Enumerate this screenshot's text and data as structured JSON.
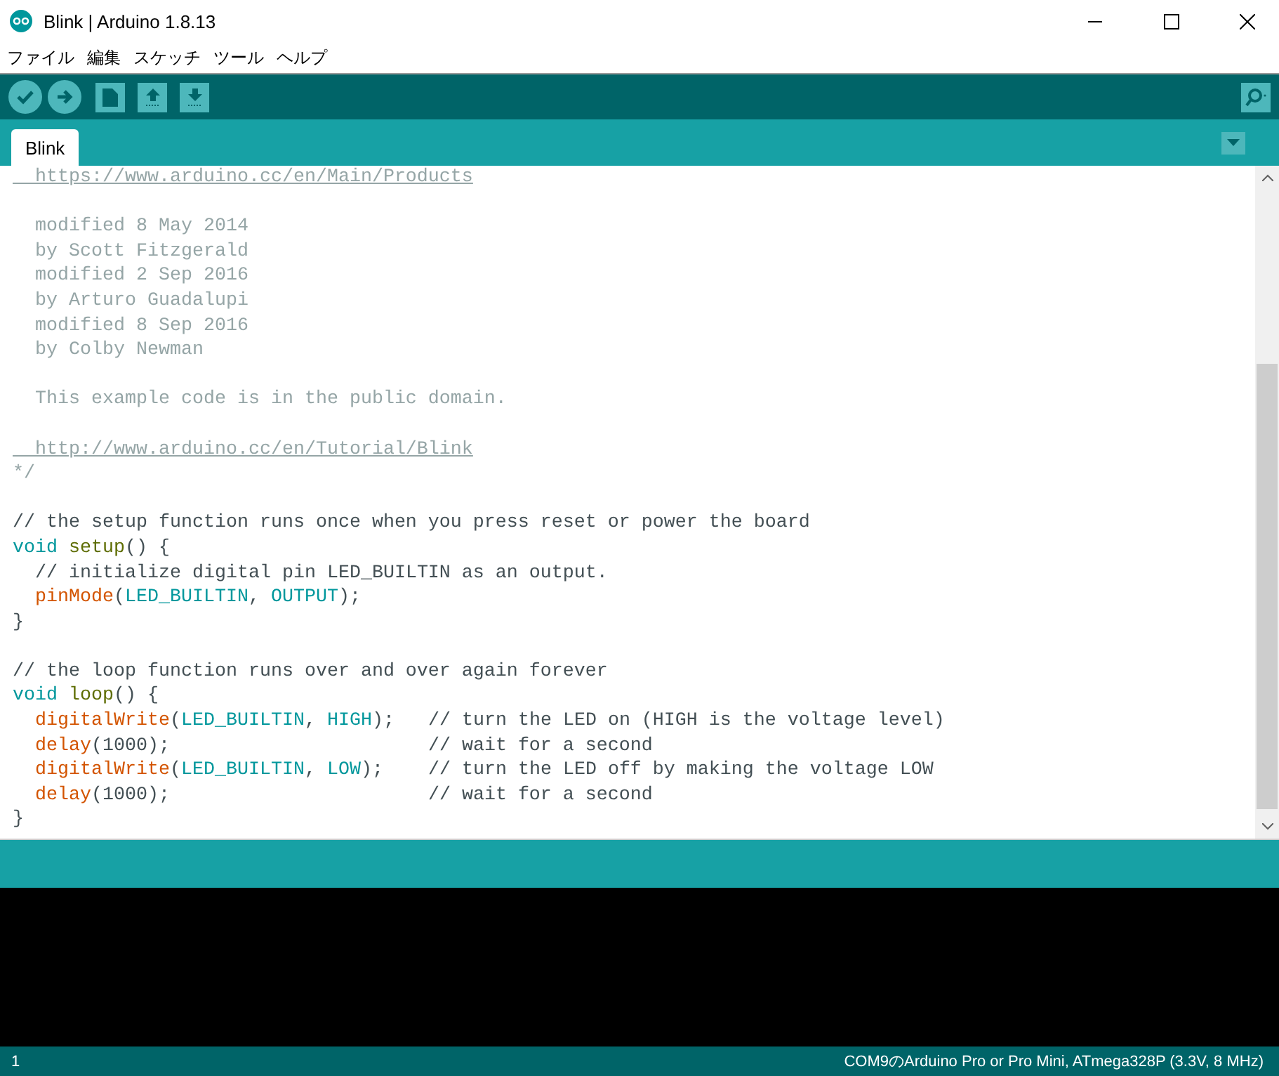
{
  "window": {
    "title": "Blink | Arduino 1.8.13"
  },
  "menu": [
    "ファイル",
    "編集",
    "スケッチ",
    "ツール",
    "ヘルプ"
  ],
  "tabs": [
    {
      "label": "Blink",
      "selected": true
    }
  ],
  "code_lines": [
    {
      "kind": "code",
      "indent": false,
      "tokens": [
        {
          "kind": "link",
          "text": "  https://www.arduino.cc/en/Main/Products"
        }
      ]
    },
    {
      "kind": "blank"
    },
    {
      "kind": "code",
      "indent": false,
      "tokens": [
        {
          "kind": "block",
          "text": "  modified 8 May 2014"
        }
      ]
    },
    {
      "kind": "code",
      "indent": false,
      "tokens": [
        {
          "kind": "block",
          "text": "  by Scott Fitzgerald"
        }
      ]
    },
    {
      "kind": "code",
      "indent": false,
      "tokens": [
        {
          "kind": "block",
          "text": "  modified 2 Sep 2016"
        }
      ]
    },
    {
      "kind": "code",
      "indent": false,
      "tokens": [
        {
          "kind": "block",
          "text": "  by Arturo Guadalupi"
        }
      ]
    },
    {
      "kind": "code",
      "indent": false,
      "tokens": [
        {
          "kind": "block",
          "text": "  modified 8 Sep 2016"
        }
      ]
    },
    {
      "kind": "code",
      "indent": false,
      "tokens": [
        {
          "kind": "block",
          "text": "  by Colby Newman"
        }
      ]
    },
    {
      "kind": "blank"
    },
    {
      "kind": "code",
      "indent": false,
      "tokens": [
        {
          "kind": "block",
          "text": "  This example code is in the public domain."
        }
      ]
    },
    {
      "kind": "blank"
    },
    {
      "kind": "code",
      "indent": false,
      "tokens": [
        {
          "kind": "link",
          "text": "  http://www.arduino.cc/en/Tutorial/Blink"
        }
      ]
    },
    {
      "kind": "code",
      "indent": false,
      "tokens": [
        {
          "kind": "block",
          "text": "*/"
        }
      ]
    },
    {
      "kind": "blank"
    },
    {
      "kind": "code",
      "indent": false,
      "tokens": [
        {
          "kind": "comment",
          "text": "// the setup function runs once when you press reset or power the board"
        }
      ]
    },
    {
      "kind": "code",
      "indent": false,
      "tokens": [
        {
          "kind": "keyword",
          "text": "void "
        },
        {
          "kind": "name",
          "text": "setup"
        },
        {
          "kind": "plain",
          "text": "() {"
        }
      ]
    },
    {
      "kind": "code",
      "indent": true,
      "tokens": [
        {
          "kind": "comment",
          "text": "// initialize digital pin LED_BUILTIN as an output."
        }
      ]
    },
    {
      "kind": "code",
      "indent": true,
      "tokens": [
        {
          "kind": "function",
          "text": "pinMode"
        },
        {
          "kind": "plain",
          "text": "("
        },
        {
          "kind": "constant",
          "text": "LED_BUILTIN"
        },
        {
          "kind": "plain",
          "text": ", "
        },
        {
          "kind": "constant",
          "text": "OUTPUT"
        },
        {
          "kind": "plain",
          "text": ");"
        }
      ]
    },
    {
      "kind": "code",
      "indent": false,
      "tokens": [
        {
          "kind": "plain",
          "text": "}"
        }
      ]
    },
    {
      "kind": "blank"
    },
    {
      "kind": "code",
      "indent": false,
      "tokens": [
        {
          "kind": "comment",
          "text": "// the loop function runs over and over again forever"
        }
      ]
    },
    {
      "kind": "code",
      "indent": false,
      "tokens": [
        {
          "kind": "keyword",
          "text": "void "
        },
        {
          "kind": "name",
          "text": "loop"
        },
        {
          "kind": "plain",
          "text": "() {"
        }
      ]
    },
    {
      "kind": "code",
      "indent": true,
      "tokens": [
        {
          "kind": "function",
          "text": "digitalWrite"
        },
        {
          "kind": "plain",
          "text": "("
        },
        {
          "kind": "constant",
          "text": "LED_BUILTIN"
        },
        {
          "kind": "plain",
          "text": ", "
        },
        {
          "kind": "constant",
          "text": "HIGH"
        },
        {
          "kind": "plain",
          "text": ");   "
        },
        {
          "kind": "comment",
          "text": "// turn the LED on (HIGH is the voltage level)"
        }
      ]
    },
    {
      "kind": "code",
      "indent": true,
      "tokens": [
        {
          "kind": "function",
          "text": "delay"
        },
        {
          "kind": "plain",
          "text": "(1000);                       "
        },
        {
          "kind": "comment",
          "text": "// wait for a second"
        }
      ]
    },
    {
      "kind": "code",
      "indent": true,
      "tokens": [
        {
          "kind": "function",
          "text": "digitalWrite"
        },
        {
          "kind": "plain",
          "text": "("
        },
        {
          "kind": "constant",
          "text": "LED_BUILTIN"
        },
        {
          "kind": "plain",
          "text": ", "
        },
        {
          "kind": "constant",
          "text": "LOW"
        },
        {
          "kind": "plain",
          "text": ");    "
        },
        {
          "kind": "comment",
          "text": "// turn the LED off by making the voltage LOW"
        }
      ]
    },
    {
      "kind": "code",
      "indent": true,
      "tokens": [
        {
          "kind": "function",
          "text": "delay"
        },
        {
          "kind": "plain",
          "text": "(1000);                       "
        },
        {
          "kind": "comment",
          "text": "// wait for a second"
        }
      ]
    },
    {
      "kind": "code",
      "indent": false,
      "tokens": [
        {
          "kind": "plain",
          "text": "}"
        }
      ]
    }
  ],
  "status_bar": {
    "line": "1",
    "board": "COM9のArduino Pro or Pro Mini, ATmega328P (3.3V, 8 MHz)"
  }
}
